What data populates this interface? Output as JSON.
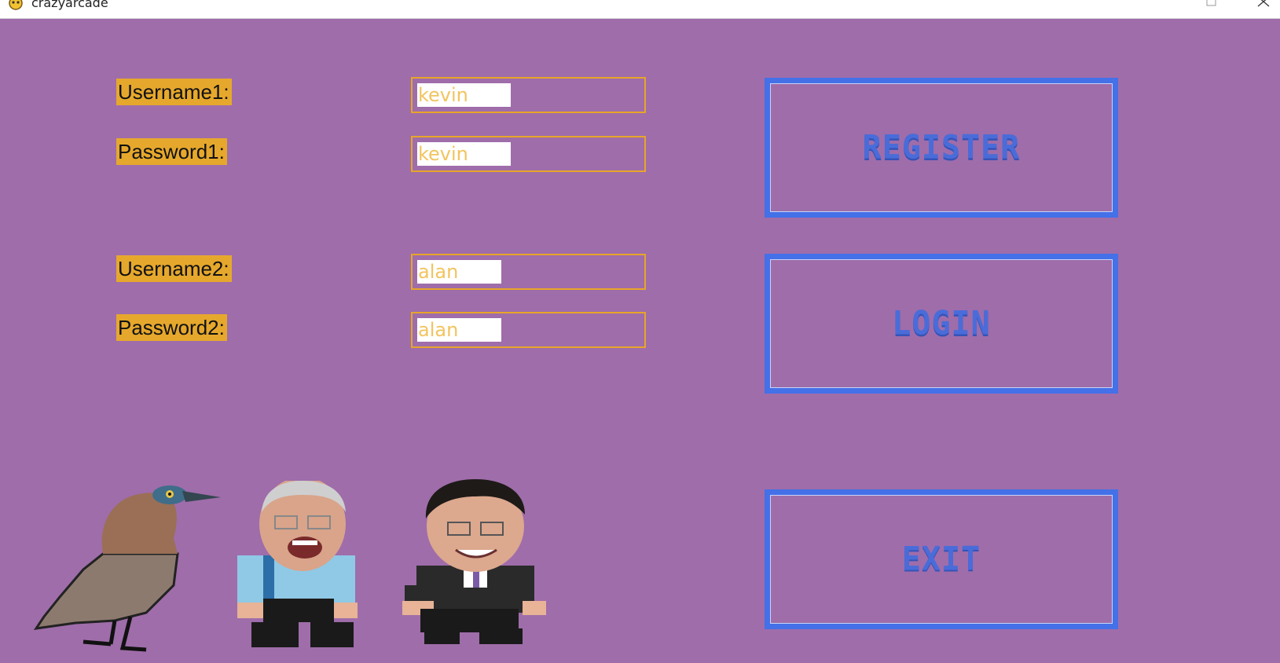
{
  "window": {
    "title": "crazyarcade"
  },
  "form": {
    "player1": {
      "username_label": "Username1:",
      "username_value": "kevin",
      "password_label": "Password1:",
      "password_value": "kevin"
    },
    "player2": {
      "username_label": "Username2:",
      "username_value": "alan",
      "password_label": "Password2:",
      "password_value": "alan"
    }
  },
  "buttons": {
    "register": "REGISTER",
    "login": "LOGIN",
    "exit": "EXIT"
  },
  "characters": [
    "bird-character",
    "player-character-1",
    "player-character-2"
  ],
  "colors": {
    "background": "#9f6daa",
    "label_bg": "#e6a82c",
    "input_border": "#e8a528",
    "button_border": "#4470e8",
    "button_text": "#4a6cd9"
  }
}
